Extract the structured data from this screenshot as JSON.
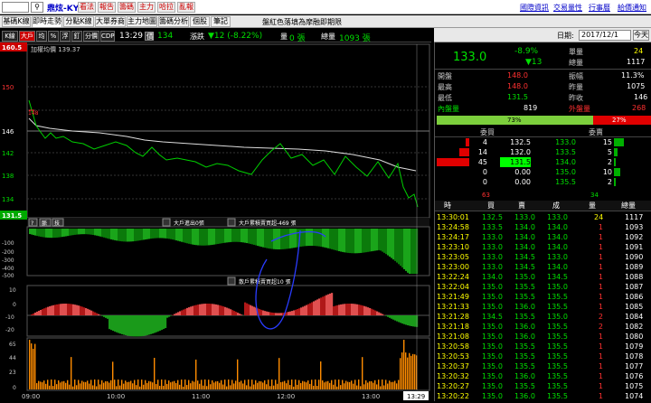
{
  "topbar": {
    "symbol_value": "",
    "stock_name": "鼎炫-KY",
    "buttons": [
      "看法",
      "報告",
      "籌碼",
      "主力",
      "哈拉",
      "亂報"
    ],
    "right_links": [
      "國際資訊",
      "交易量性",
      "行事曆",
      "給價通知"
    ]
  },
  "tabs": [
    {
      "label": "基碼K線",
      "active": false
    },
    {
      "label": "即時走勢",
      "active": true
    },
    {
      "label": "分點K線",
      "active": false
    },
    {
      "label": "大單券商",
      "active": false
    },
    {
      "label": "主力地圖",
      "active": false
    },
    {
      "label": "籌碼分析",
      "active": false
    },
    {
      "label": "個股",
      "active": false
    },
    {
      "label": "筆記",
      "active": false
    }
  ],
  "notice": "盤紅色落填為摩融即期限",
  "infobar": {
    "mode_buttons": [
      "K線",
      "大戶",
      "均",
      "%",
      "浮",
      "釘",
      "分價",
      "CDP"
    ],
    "time": "13:29",
    "price_label": "價",
    "price_value": "134",
    "change_label": "漲跌",
    "change_value": "▼12 (-8.22%)",
    "vol_label": "量",
    "vol_value": "0 張",
    "total_label": "總量",
    "total_value": "1093 張"
  },
  "chart": {
    "avg_label": "加權均價 139.37",
    "yaxis": [
      "160.5",
      "150",
      "146",
      "142",
      "138",
      "134",
      "131.5"
    ],
    "tool_buttons": [
      "?",
      "脈",
      "技"
    ],
    "big_label": "大戶進出0張",
    "big_label2": "大戶累積賣買超-469 張",
    "big_axis": [
      "-100",
      "-200",
      "-300",
      "-400",
      "-500"
    ],
    "retail_label": "散戶累積賣買超10 張",
    "retail_axis": [
      "10",
      "0",
      "-10",
      "-20"
    ],
    "vol_axis": [
      "65",
      "44",
      "23",
      "0"
    ],
    "xaxis": [
      "09:00",
      "10:00",
      "11:00",
      "12:00",
      "13:00"
    ],
    "xcursor": "13:29"
  },
  "right": {
    "date_label": "日期:",
    "date_value": "2017/12/1",
    "today_button": "今天",
    "price": "133.0",
    "pct": "-8.9%",
    "chg": "▼13",
    "single_label": "單量",
    "single_val": "24",
    "total_label": "總量",
    "total_val": "1117",
    "open_label": "開盤",
    "open_val": "148.0",
    "amp_label": "振幅",
    "amp_val": "11.3%",
    "high_label": "最高",
    "high_val": "148.0",
    "yvol_label": "昨量",
    "yvol_val": "1075",
    "low_label": "最低",
    "low_val": "131.5",
    "prev_label": "昨收",
    "prev_val": "146",
    "in_label": "內盤量",
    "in_val": "819",
    "out_label": "外盤量",
    "out_val": "268",
    "in_pct": "73%",
    "out_pct": "27%",
    "in_fraction": 0.73,
    "buy_head": "委買",
    "sell_head": "委賣",
    "book": [
      {
        "bv": "4",
        "bp": "132.5",
        "sp": "133.0",
        "sv": "15",
        "bvw": 0.1,
        "svw": 0.3
      },
      {
        "bv": "14",
        "bp": "132.0",
        "sp": "133.5",
        "sv": "5",
        "bvw": 0.3,
        "svw": 0.1
      },
      {
        "bv": "45",
        "bp": "131.5",
        "sp": "134.0",
        "sv": "2",
        "bvw": 1.0,
        "svw": 0.05
      },
      {
        "bv": "0",
        "bp": "0.00",
        "sp": "135.0",
        "sv": "10",
        "bvw": 0,
        "svw": 0.2
      },
      {
        "bv": "0",
        "bp": "0.00",
        "sp": "135.5",
        "sv": "2",
        "bvw": 0,
        "svw": 0.05
      }
    ],
    "book_sum_buy": "63",
    "book_sum_sell": "34",
    "trade_headers": [
      "時",
      "買",
      "賣",
      "成",
      "量",
      "總量"
    ],
    "trades": [
      [
        "13:30:01",
        "132.5",
        "133.0",
        "133.0",
        "24",
        "1117"
      ],
      [
        "13:24:58",
        "133.5",
        "134.0",
        "134.0",
        "1",
        "1093"
      ],
      [
        "13:24:17",
        "133.0",
        "134.0",
        "134.0",
        "1",
        "1092"
      ],
      [
        "13:23:10",
        "133.0",
        "134.0",
        "134.0",
        "1",
        "1091"
      ],
      [
        "13:23:05",
        "133.0",
        "134.5",
        "133.0",
        "1",
        "1090"
      ],
      [
        "13:23:00",
        "133.0",
        "134.5",
        "134.0",
        "1",
        "1089"
      ],
      [
        "13:22:24",
        "134.0",
        "135.0",
        "134.5",
        "1",
        "1088"
      ],
      [
        "13:22:04",
        "135.0",
        "135.5",
        "135.0",
        "1",
        "1087"
      ],
      [
        "13:21:49",
        "135.0",
        "135.5",
        "135.5",
        "1",
        "1086"
      ],
      [
        "13:21:33",
        "135.0",
        "136.0",
        "135.5",
        "1",
        "1085"
      ],
      [
        "13:21:28",
        "134.5",
        "135.5",
        "135.0",
        "2",
        "1084"
      ],
      [
        "13:21:18",
        "135.0",
        "136.0",
        "135.5",
        "2",
        "1082"
      ],
      [
        "13:21:08",
        "135.0",
        "136.0",
        "135.5",
        "1",
        "1080"
      ],
      [
        "13:20:58",
        "135.0",
        "135.5",
        "135.5",
        "1",
        "1079"
      ],
      [
        "13:20:53",
        "135.0",
        "135.5",
        "135.5",
        "1",
        "1078"
      ],
      [
        "13:20:37",
        "135.0",
        "135.5",
        "135.5",
        "1",
        "1077"
      ],
      [
        "13:20:32",
        "135.0",
        "136.0",
        "135.5",
        "1",
        "1076"
      ],
      [
        "13:20:27",
        "135.0",
        "135.5",
        "135.5",
        "1",
        "1075"
      ],
      [
        "13:20:22",
        "135.0",
        "136.0",
        "135.5",
        "1",
        "1074"
      ]
    ]
  },
  "colors": {
    "up": "#ff3030",
    "down": "#00e000",
    "bar": "#ff8c00"
  }
}
